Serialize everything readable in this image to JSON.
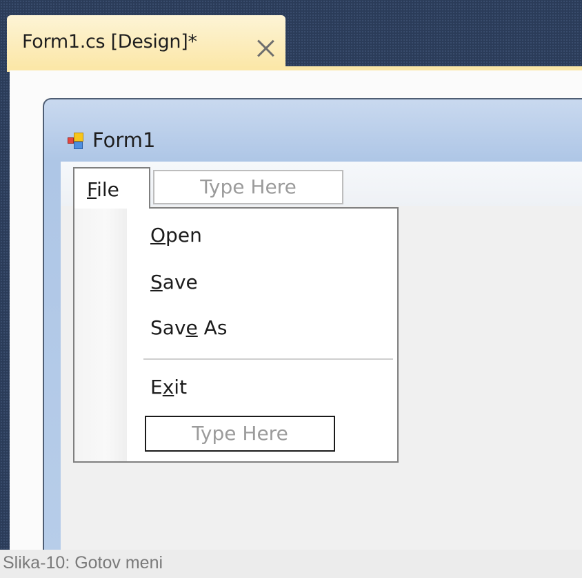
{
  "document_tab": {
    "title": "Form1.cs [Design]*",
    "close_icon": "close-icon"
  },
  "form": {
    "icon": "form-icon",
    "title": "Form1"
  },
  "menu_bar": {
    "file_label": "File",
    "file_mnemonic": "F",
    "type_here": "Type Here"
  },
  "file_menu": {
    "items": [
      {
        "label": "Open",
        "mnemonic_index": 0
      },
      {
        "label": "Save",
        "mnemonic_index": 0
      },
      {
        "label": "Save As",
        "mnemonic_index": 3
      },
      {
        "label": "Exit",
        "mnemonic_index": 1
      }
    ],
    "type_here": "Type Here"
  },
  "caption": "Slika-10: Gotov meni"
}
